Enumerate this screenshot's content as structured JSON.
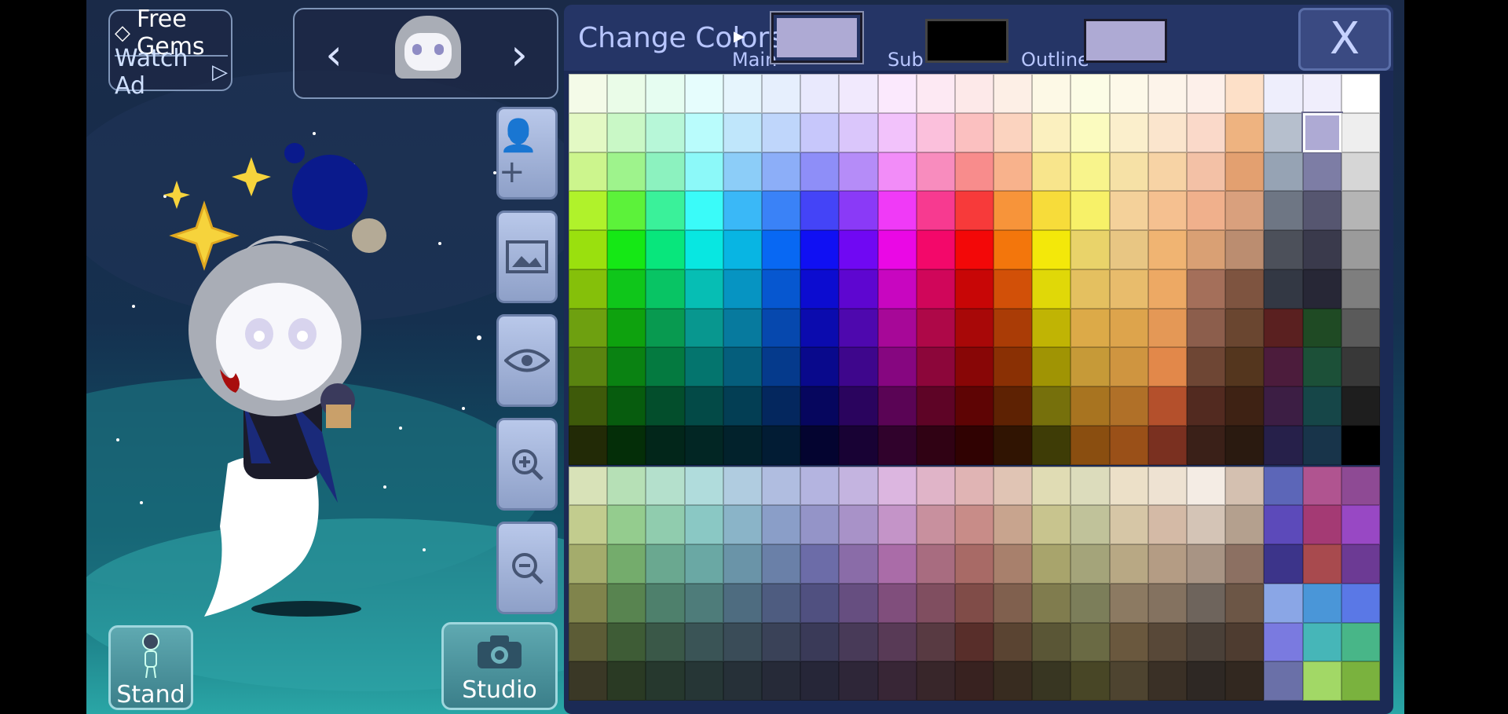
{
  "top_left": {
    "free_gems_label": "Free Gems",
    "watch_ad_label": "Watch Ad",
    "gem_icon": "gem-icon",
    "play_icon": "play-icon"
  },
  "character_nav": {
    "prev_icon": "chevron-left-icon",
    "next_icon": "chevron-right-icon",
    "avatar_icon": "character-head-icon"
  },
  "side_buttons": [
    {
      "name": "add-character-button",
      "icon": "add-user-icon"
    },
    {
      "name": "background-button",
      "icon": "image-icon"
    },
    {
      "name": "visibility-button",
      "icon": "eye-icon"
    },
    {
      "name": "zoom-in-button",
      "icon": "zoom-in-icon"
    },
    {
      "name": "zoom-out-button",
      "icon": "zoom-out-icon"
    }
  ],
  "bottom": {
    "stand_label": "Stand",
    "studio_label": "Studio"
  },
  "color_panel": {
    "title": "Change Colors",
    "main_label": "Main",
    "sub_label": "Sub",
    "outline_label": "Outline",
    "close_label": "X",
    "main_color": "#aeaad4",
    "sub_color": "#000000",
    "outline_color": "#aeaad4",
    "selected_cell": [
      1,
      19
    ],
    "palette": [
      [
        "#f4fbe8",
        "#eafce8",
        "#e6fdf1",
        "#e6fdfd",
        "#e6f5fd",
        "#e6effd",
        "#e9e9fd",
        "#f1e9fd",
        "#fbe9fd",
        "#fde9f3",
        "#fde9e9",
        "#fdefe6",
        "#fdf9e6",
        "#fcfde6",
        "#fdf9e9",
        "#fdf4ea",
        "#fdf0ea",
        "#fde0c8",
        "#eeeefc",
        "#f0eefc",
        "#ffffff"
      ],
      [
        "#e3f9c4",
        "#c9f8c6",
        "#b7f7d8",
        "#b9fcfc",
        "#bfe6fb",
        "#bfd6fb",
        "#c7c7fb",
        "#dac6fb",
        "#f2c2fb",
        "#fbc0dc",
        "#fbc0c0",
        "#fbd3bf",
        "#fbf0bf",
        "#fbfbbf",
        "#fbefcc",
        "#fbe5cd",
        "#fad9c9",
        "#eeb380",
        "#b6bfcd",
        "#aeaad4",
        "#eeeeee"
      ],
      [
        "#ccf58d",
        "#9ef38c",
        "#8cf2bf",
        "#8cf9f9",
        "#8ccdf8",
        "#8caef8",
        "#8e8ef8",
        "#b58cf8",
        "#f28cf8",
        "#f88cbe",
        "#f88c8c",
        "#f8b28c",
        "#f8e58c",
        "#f8f48c",
        "#f6e1a6",
        "#f7d3a5",
        "#f3c1a6",
        "#e3a070",
        "#96a3b4",
        "#7d7da5",
        "#d6d6d6"
      ],
      [
        "#b0f22b",
        "#5cf23a",
        "#3af19a",
        "#3afbf9",
        "#3ab8f7",
        "#3a82f7",
        "#4444f7",
        "#8a3af7",
        "#f03af7",
        "#f73a90",
        "#f73a3a",
        "#f7943a",
        "#f7dc3a",
        "#f7f168",
        "#f4d19a",
        "#f5c090",
        "#f0b08c",
        "#d9a07d",
        "#6e7684",
        "#565670",
        "#b5b5b5"
      ],
      [
        "#9ae00e",
        "#15e815",
        "#08e67c",
        "#08e7e1",
        "#08b5e3",
        "#0868f3",
        "#1010f3",
        "#7008f3",
        "#ea08e5",
        "#f3086a",
        "#f30808",
        "#f3760c",
        "#f3e80a",
        "#e9d36a",
        "#e8c683",
        "#f0b472",
        "#d9a074",
        "#bb8d70",
        "#4c505a",
        "#3a3a4c",
        "#9b9b9b"
      ],
      [
        "#85c00a",
        "#0fc61a",
        "#08c464",
        "#06beb4",
        "#0694c2",
        "#0657d0",
        "#0c0cd0",
        "#5e06d0",
        "#c806c0",
        "#d0065a",
        "#c80606",
        "#d25008",
        "#e0d808",
        "#e4c060",
        "#e8bc6c",
        "#eda964",
        "#a46f5a",
        "#7e5440",
        "#333844",
        "#272736",
        "#7e7e7e"
      ],
      [
        "#6ea010",
        "#0ea20e",
        "#089a50",
        "#08978f",
        "#077a9e",
        "#0648ae",
        "#0b0bae",
        "#4e08ae",
        "#a70898",
        "#ae0848",
        "#a80808",
        "#aa3c06",
        "#c0b404",
        "#dcaa48",
        "#dda44c",
        "#e49856",
        "#8c5e4c",
        "#6a4630",
        "#5a2020",
        "#1f4a24",
        "#5a5a5a"
      ],
      [
        "#5a8410",
        "#0a8212",
        "#047a40",
        "#04756e",
        "#055e7c",
        "#053a8c",
        "#09098c",
        "#3e068c",
        "#860680",
        "#8c063a",
        "#880606",
        "#8a3004",
        "#a09404",
        "#c69a38",
        "#cf9540",
        "#e2884a",
        "#6e4634",
        "#54361e",
        "#4c1c3c",
        "#1c5038",
        "#383838"
      ],
      [
        "#3e5a0a",
        "#075c0e",
        "#034e2c",
        "#034a47",
        "#033e54",
        "#04275e",
        "#06065e",
        "#2a045e",
        "#5a0455",
        "#5e0426",
        "#5e0404",
        "#5e2203",
        "#76700c",
        "#a87420",
        "#b07028",
        "#b4502c",
        "#522a20",
        "#3e2214",
        "#3c1e44",
        "#164648",
        "#1e1e1e"
      ],
      [
        "#222a06",
        "#042e08",
        "#02261a",
        "#022624",
        "#02222c",
        "#021c34",
        "#040430",
        "#180234",
        "#30022c",
        "#300214",
        "#300202",
        "#301402",
        "#3e3c06",
        "#8a4e10",
        "#9a5018",
        "#7a3020",
        "#3a2018",
        "#2a1a10",
        "#26204a",
        "#18344a",
        "#000000"
      ],
      [
        "#d8e2b8",
        "#b6e0b6",
        "#b4e0cc",
        "#b0dcdc",
        "#b0cce0",
        "#b0bde0",
        "#b4b4e0",
        "#c4b4e0",
        "#dcb6e0",
        "#e0b4c8",
        "#e0b4b4",
        "#e0c4b4",
        "#e0dcb4",
        "#dcdcbc",
        "#ece0c8",
        "#eee2d2",
        "#f4ece4",
        "#d4c0b0",
        "#5c66b8",
        "#b05490",
        "#8e4a94"
      ],
      [
        "#c2cc8e",
        "#94cc8e",
        "#90ccae",
        "#8ac8c4",
        "#8ab4c8",
        "#8a9ec8",
        "#9494c8",
        "#a892c8",
        "#c494c8",
        "#c8909e",
        "#c88c88",
        "#c8a48e",
        "#c8c48e",
        "#c0c29a",
        "#d6c6a6",
        "#d4baa6",
        "#d4c4b6",
        "#b4a08e",
        "#5c4aba",
        "#a43a74",
        "#9848c4"
      ],
      [
        "#a4ac6c",
        "#74ac6c",
        "#6aa890",
        "#6aa8a4",
        "#6a94a8",
        "#6a80a8",
        "#6c6ca8",
        "#8a6ca8",
        "#aa6ca8",
        "#a86c80",
        "#a86a66",
        "#a8806c",
        "#a8a46c",
        "#a4a47a",
        "#b8a884",
        "#b49c84",
        "#a89484",
        "#8c7062",
        "#3c348a",
        "#a84a4e",
        "#6c3a94"
      ],
      [
        "#80844c",
        "#588450",
        "#4e806c",
        "#4e7c7a",
        "#4e6c80",
        "#4e5c80",
        "#505080",
        "#664e80",
        "#804e7c",
        "#804e60",
        "#804c48",
        "#80604e",
        "#807c4e",
        "#7c7e5a",
        "#8c7a62",
        "#847260",
        "#6e645c",
        "#6c5646",
        "#8aa6e6",
        "#4a96d8",
        "#5a78e6"
      ],
      [
        "#5c5c36",
        "#3e5c36",
        "#3a5848",
        "#3a5456",
        "#3a4c58",
        "#3a4258",
        "#3a3a58",
        "#483a58",
        "#583a56",
        "#583a42",
        "#582e2a",
        "#5a4432",
        "#5a5636",
        "#6a6a44",
        "#6a583e",
        "#584838",
        "#4a4038",
        "#4e3c30",
        "#7a7ae0",
        "#46b6b8",
        "#48b688"
      ],
      [
        "#3a3826",
        "#2a3a24",
        "#26382e",
        "#263636",
        "#263038",
        "#262a38",
        "#262638",
        "#2e2638",
        "#382636",
        "#38262a",
        "#382220",
        "#382c20",
        "#383622",
        "#484626",
        "#4e4430",
        "#3a3026",
        "#2e2824",
        "#322820",
        "#6a70a8",
        "#a2d866",
        "#7ab23e"
      ]
    ]
  }
}
